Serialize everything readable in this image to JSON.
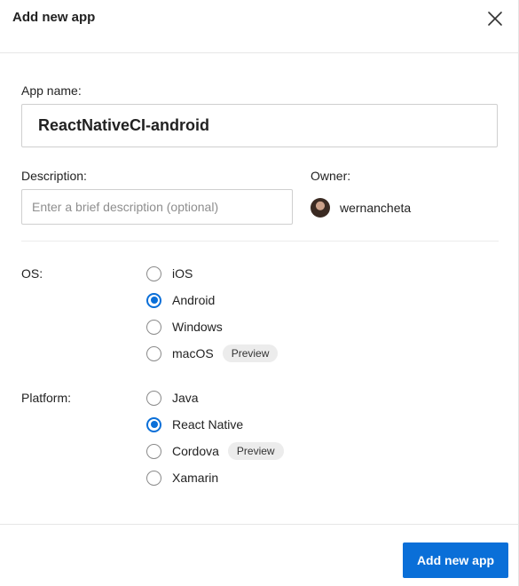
{
  "dialog": {
    "title": "Add new app",
    "close_icon": "close-icon"
  },
  "form": {
    "app_name_label": "App name:",
    "app_name_value": "ReactNativeCI-android",
    "description_label": "Description:",
    "description_placeholder": "Enter a brief description (optional)",
    "description_value": "",
    "owner_label": "Owner:",
    "owner_name": "wernancheta",
    "os_label": "OS:",
    "os_options": [
      {
        "label": "iOS",
        "selected": false,
        "badge": ""
      },
      {
        "label": "Android",
        "selected": true,
        "badge": ""
      },
      {
        "label": "Windows",
        "selected": false,
        "badge": ""
      },
      {
        "label": "macOS",
        "selected": false,
        "badge": "Preview"
      }
    ],
    "platform_label": "Platform:",
    "platform_options": [
      {
        "label": "Java",
        "selected": false,
        "badge": ""
      },
      {
        "label": "React Native",
        "selected": true,
        "badge": ""
      },
      {
        "label": "Cordova",
        "selected": false,
        "badge": "Preview"
      },
      {
        "label": "Xamarin",
        "selected": false,
        "badge": ""
      }
    ]
  },
  "footer": {
    "submit_label": "Add new app"
  },
  "colors": {
    "accent": "#0a6fd8",
    "text": "#222222",
    "border": "#cfcfcf",
    "badge_bg": "#ececec"
  }
}
